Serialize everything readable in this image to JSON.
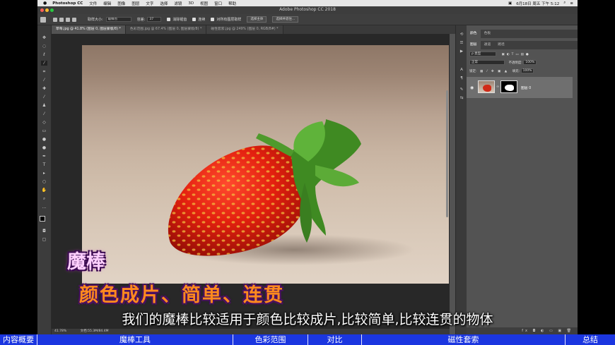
{
  "menubar": {
    "apple": "",
    "items": [
      "Photoshop CC",
      "文件",
      "编辑",
      "图像",
      "图层",
      "文字",
      "选择",
      "滤镜",
      "3D",
      "视图",
      "窗口",
      "帮助"
    ],
    "clock": "6月18日 周五 下午 5:12"
  },
  "window": {
    "title": "Adobe Photoshop CC 2018"
  },
  "options": {
    "sample_size_label": "取样大小:",
    "sample_size_value": "取样点",
    "tolerance_label": "容差:",
    "tolerance_value": "37",
    "antialias_label": "消除锯齿",
    "contiguous_label": "连续",
    "all_layers_label": "对所有图层取样",
    "select_subject_label": "选择主体",
    "select_mask_label": "选择并遮住..."
  },
  "tabs": [
    {
      "label": "草莓.jpg @ 41.8% (图层 0, 图层蒙版/8) *",
      "active": true
    },
    {
      "label": "色彩范围.jpg @ 67.4% (图层 0, 图层蒙版/8) *",
      "active": false
    },
    {
      "label": "磁性套索.jpg @ 249% (图层 0, RGB/8#) *",
      "active": false
    }
  ],
  "status": {
    "zoom": "41.78%",
    "doc": "文档:55.3M/84.4M"
  },
  "panels": {
    "top_tabs": [
      "颜色",
      "色板"
    ],
    "layer_tabs": [
      "图层",
      "通道",
      "路径"
    ],
    "kind_label": "ρ 类型",
    "blend_mode": "正常",
    "opacity_label": "不透明度:",
    "opacity_value": "100%",
    "lock_label": "锁定:",
    "fill_label": "填充:",
    "fill_value": "100%",
    "layer_name": "图层 0",
    "bottom_icons": "fx ◘ ◐ ▭ ▣ 🗑"
  },
  "overlay": {
    "title": "魔棒",
    "subtitle": "颜色成片、简单、连贯",
    "caption": "我们的魔棒比较适用于颜色比较成片,比较简单,比较连贯的物体"
  },
  "chapters": [
    {
      "label": "内容概要"
    },
    {
      "label": "魔棒工具",
      "active": true
    },
    {
      "label": "色彩范围"
    },
    {
      "label": "对比"
    },
    {
      "label": "磁性套索"
    },
    {
      "label": "总结"
    }
  ],
  "colors": {
    "chapter_bar": "#1b36e0",
    "title_fill": "#ffd0ff",
    "subtitle_fill": "#ff8a1e"
  }
}
